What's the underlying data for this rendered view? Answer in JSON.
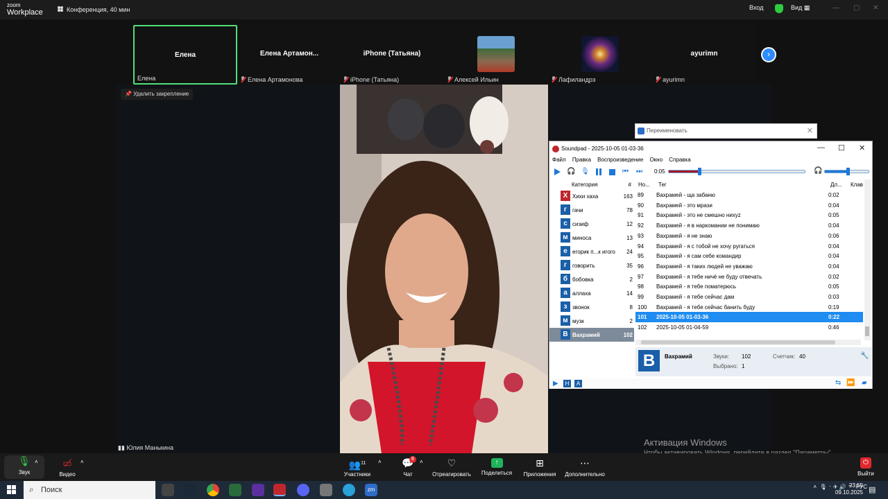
{
  "header": {
    "app_name_small": "zoom",
    "app_name": "Workplace",
    "meeting_title": "Конференция, 40 мин",
    "enter_label": "Вход",
    "view_label": "Вид"
  },
  "participants": [
    {
      "display": "Елена",
      "caption": "Елена",
      "muted": false,
      "active": true
    },
    {
      "display": "Елена  Артамон...",
      "caption": "Елена Артамонова",
      "muted": true
    },
    {
      "display": "iPhone (Татьяна)",
      "caption": "iPhone (Татьяна)",
      "muted": true
    },
    {
      "display": "",
      "caption": "Алексей Ильин",
      "muted": true
    },
    {
      "display": "",
      "caption": "Лафиландрэ",
      "muted": true
    },
    {
      "display": "ayurimn",
      "caption": "ayurimn",
      "muted": true
    }
  ],
  "unpin_label": "Удалить закрепление",
  "speaker_name": "Юлия Манькина",
  "activation": {
    "title": "Активация Windows",
    "subtitle": "Чтобы активировать Windows, перейдите в раздел \"Параметры\"."
  },
  "rename_dialog": {
    "title": "Переименовать"
  },
  "soundpad": {
    "title": "Soundpad - 2025-10-05 01-03-36",
    "menu": [
      "Файл",
      "Правка",
      "Воспроизведение",
      "Окно",
      "Справка"
    ],
    "time": "0:05",
    "seek_fraction": 0.22,
    "volume_fraction": 0.5,
    "cat_header": {
      "name": "Категория",
      "count": "#"
    },
    "categories": [
      {
        "letter": "Х",
        "name": "Хихи хаха",
        "count": "163",
        "color": "#c0272d"
      },
      {
        "letter": "г",
        "name": "гачи",
        "count": "78",
        "color": "#1a5fa8"
      },
      {
        "letter": "с",
        "name": "сизиф",
        "count": "12",
        "color": "#1a5fa8"
      },
      {
        "letter": "м",
        "name": "миноса",
        "count": "13",
        "color": "#1a5fa8"
      },
      {
        "letter": "е",
        "name": "егорик п...к игого",
        "count": "24",
        "color": "#1a5fa8"
      },
      {
        "letter": "г",
        "name": "говорить",
        "count": "35",
        "color": "#1a5fa8"
      },
      {
        "letter": "б",
        "name": "бобовка",
        "count": "2",
        "color": "#1a5fa8"
      },
      {
        "letter": "а",
        "name": "аллаха",
        "count": "14",
        "color": "#1a5fa8"
      },
      {
        "letter": "з",
        "name": "звонок",
        "count": "8",
        "color": "#1a5fa8"
      },
      {
        "letter": "м",
        "name": "музк",
        "count": "2",
        "color": "#1a5fa8"
      },
      {
        "letter": "В",
        "name": "Вахрамий",
        "count": "102",
        "color": "#1a5fa8",
        "selected": true
      }
    ],
    "snd_header": {
      "num": "Но...",
      "tag": "Тег",
      "dur": "Дл...",
      "key": "Клав"
    },
    "sounds": [
      {
        "n": "89",
        "t": "Вахрамей - ща забаню",
        "d": "0:02"
      },
      {
        "n": "90",
        "t": "Вахрамей - это мрази",
        "d": "0:04"
      },
      {
        "n": "91",
        "t": "Вахрамей - это не смешно нихуz",
        "d": "0:05"
      },
      {
        "n": "92",
        "t": "Вахрамей - я в наркомании не понимаю",
        "d": "0:04"
      },
      {
        "n": "93",
        "t": "Вахрамей - я не знаю",
        "d": "0:06"
      },
      {
        "n": "94",
        "t": "Вахрамей - я с тобой не хочу ругаться",
        "d": "0:04"
      },
      {
        "n": "95",
        "t": "Вахрамей - я сам себе командир",
        "d": "0:04"
      },
      {
        "n": "96",
        "t": "Вахрамей - я таких людей не уважаю",
        "d": "0:04"
      },
      {
        "n": "97",
        "t": "Вахрамей - я тебе ничё не буду отвечать",
        "d": "0:02"
      },
      {
        "n": "98",
        "t": "Вахрамей - я тебе поматерюсь",
        "d": "0:05"
      },
      {
        "n": "99",
        "t": "Вахрамей - я тебе сейчас дам",
        "d": "0:03"
      },
      {
        "n": "100",
        "t": "Вахрамей - я тебе сейчас банить буду",
        "d": "0:19"
      },
      {
        "n": "101",
        "t": "2025-10-05 01-03-36",
        "d": "0:22",
        "selected": true
      },
      {
        "n": "102",
        "t": "2025-10-05 01-04-59",
        "d": "0:46"
      }
    ],
    "info": {
      "letter": "В",
      "name": "Вахрамий",
      "sounds_label": "Звуки:",
      "sounds_value": "102",
      "selected_label": "Выбрано:",
      "selected_value": "1",
      "counter_label": "Счетчик:",
      "counter_value": "40"
    }
  },
  "toolbar": {
    "audio": "Звук",
    "video": "Видео",
    "participants": "Участники",
    "participants_count": "11",
    "chat": "Чат",
    "chat_badge": "8",
    "react": "Отреагировать",
    "share": "Поделиться",
    "apps": "Приложения",
    "more": "Дополнительно",
    "leave": "Выйти"
  },
  "taskbar": {
    "search_placeholder": "Поиск",
    "lang": "РУС",
    "time": "23:55",
    "date": "09.10.2025"
  }
}
